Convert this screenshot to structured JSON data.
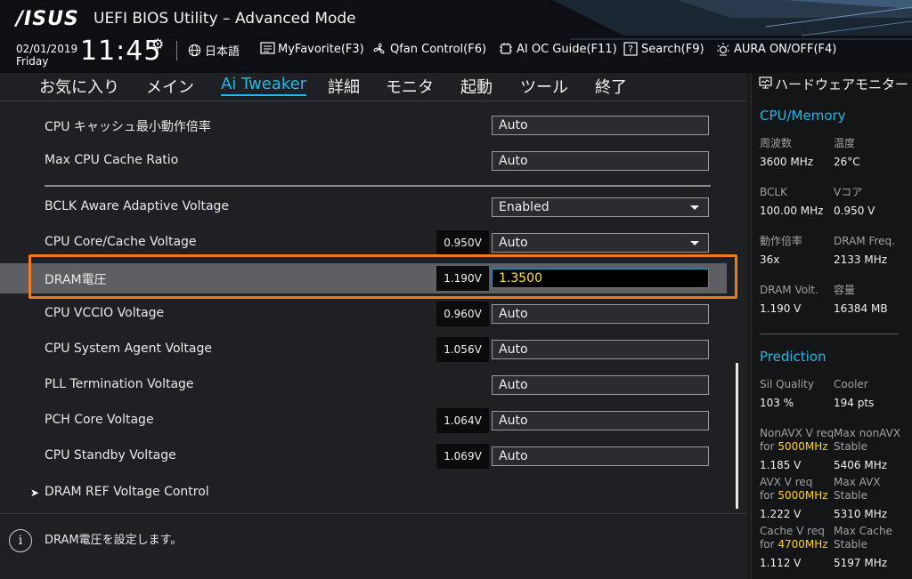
{
  "header": {
    "logo": "/ISUS",
    "title": "UEFI BIOS Utility – Advanced Mode",
    "date": "02/01/2019",
    "day": "Friday",
    "time": "11:45",
    "tools": [
      {
        "icon": "globe-icon",
        "label": "日本語"
      },
      {
        "icon": "favorite-icon",
        "label": "MyFavorite(F3)"
      },
      {
        "icon": "fan-icon",
        "label": "Qfan Control(F6)"
      },
      {
        "icon": "ai-guide-icon",
        "label": "AI OC Guide(F11)"
      },
      {
        "icon": "search-icon",
        "label": "Search(F9)"
      },
      {
        "icon": "aura-icon",
        "label": "AURA ON/OFF(F4)"
      }
    ]
  },
  "nav": {
    "tabs": [
      "お気に入り",
      "メイン",
      "Ai Tweaker",
      "詳細",
      "モニタ",
      "起動",
      "ツール",
      "終了"
    ],
    "active": "Ai Tweaker"
  },
  "settings": [
    {
      "label": "CPU キャッシュ最小動作倍率",
      "value": "Auto",
      "voltage": ""
    },
    {
      "label": "Max CPU Cache Ratio",
      "value": "Auto",
      "voltage": ""
    },
    {
      "label": "BCLK Aware Adaptive Voltage",
      "value": "Enabled",
      "voltage": ""
    },
    {
      "label": "CPU Core/Cache Voltage",
      "value": "Auto",
      "voltage": "0.950V"
    },
    {
      "label": "DRAM電圧",
      "value": "1.3500",
      "voltage": "1.190V"
    },
    {
      "label": "CPU VCCIO Voltage",
      "value": "Auto",
      "voltage": "0.960V"
    },
    {
      "label": "CPU System Agent Voltage",
      "value": "Auto",
      "voltage": "1.056V"
    },
    {
      "label": "PLL Termination Voltage",
      "value": "Auto",
      "voltage": ""
    },
    {
      "label": "PCH Core Voltage",
      "value": "Auto",
      "voltage": "1.064V"
    },
    {
      "label": "CPU Standby Voltage",
      "value": "Auto",
      "voltage": "1.069V"
    }
  ],
  "submenu": {
    "label": "DRAM REF Voltage Control"
  },
  "help": {
    "text": "DRAM電圧を設定します。"
  },
  "monitor": {
    "title": "ハードウェアモニター",
    "cpu_section": "CPU/Memory",
    "cpu": [
      {
        "label": "周波数",
        "value": "3600 MHz"
      },
      {
        "label": "温度",
        "value": "26°C"
      },
      {
        "label": "BCLK",
        "value": "100.00 MHz"
      },
      {
        "label": "Vコア",
        "value": "0.950 V"
      },
      {
        "label": "動作倍率",
        "value": "36x"
      },
      {
        "label": "DRAM Freq.",
        "value": "2133 MHz"
      },
      {
        "label": "DRAM Volt.",
        "value": "1.190 V"
      },
      {
        "label": "容量",
        "value": "16384 MB"
      }
    ],
    "pred_section": "Prediction",
    "pred": {
      "sil_label": "Sil Quality",
      "sil_value": "103 %",
      "cooler_label": "Cooler",
      "cooler_value": "194 pts",
      "nonavx_label": "NonAVX V req",
      "nonavx_for": "for",
      "nonavx_freq": "5000MHz",
      "nonavx_value": "1.185 V",
      "maxnonavx_label": "Max nonAVX",
      "maxnonavx_sub": "Stable",
      "maxnonavx_value": "5406 MHz",
      "avx_label": "AVX V req",
      "avx_for": "for",
      "avx_freq": "5000MHz",
      "avx_value": "1.222 V",
      "maxavx_label": "Max AVX",
      "maxavx_sub": "Stable",
      "maxavx_value": "5310 MHz",
      "cache_label": "Cache V req",
      "cache_for": "for",
      "cache_freq": "4700MHz",
      "cache_value": "1.112 V",
      "maxcache_label": "Max Cache",
      "maxcache_sub": "Stable",
      "maxcache_value": "5197 MHz"
    }
  },
  "colors": {
    "accent": "#21b8e8",
    "highlight_border": "#f07a1e",
    "edit_text": "#ffe23d",
    "freq_text": "#ffd21e"
  }
}
